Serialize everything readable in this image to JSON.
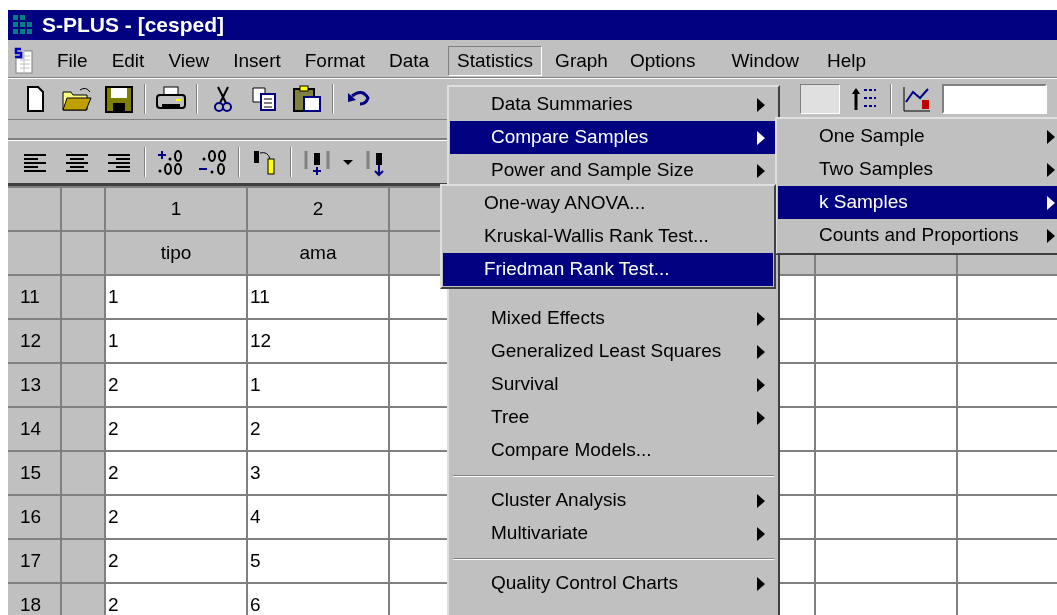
{
  "window": {
    "title": "S-PLUS - [cesped]"
  },
  "menubar": [
    {
      "label": "File",
      "selected": false
    },
    {
      "label": "Edit",
      "selected": false
    },
    {
      "label": "View",
      "selected": false
    },
    {
      "label": "Insert",
      "selected": false
    },
    {
      "label": "Format",
      "selected": false
    },
    {
      "label": "Data",
      "selected": false
    },
    {
      "label": "Statistics",
      "selected": true
    },
    {
      "label": "Graph",
      "selected": false
    },
    {
      "label": "Options",
      "selected": false
    },
    {
      "label": "Window",
      "selected": false
    },
    {
      "label": "Help",
      "selected": false
    }
  ],
  "grid": {
    "column_numbers": [
      "1",
      "2"
    ],
    "column_names": [
      "tipo",
      "ama"
    ],
    "rows": [
      {
        "row": "11",
        "cells": [
          "1",
          "11"
        ]
      },
      {
        "row": "12",
        "cells": [
          "1",
          "12"
        ]
      },
      {
        "row": "13",
        "cells": [
          "2",
          "1"
        ]
      },
      {
        "row": "14",
        "cells": [
          "2",
          "2"
        ]
      },
      {
        "row": "15",
        "cells": [
          "2",
          "3"
        ]
      },
      {
        "row": "16",
        "cells": [
          "2",
          "4"
        ]
      },
      {
        "row": "17",
        "cells": [
          "2",
          "5"
        ]
      },
      {
        "row": "18",
        "cells": [
          "2",
          "6"
        ]
      }
    ]
  },
  "statistics_menu": {
    "items_above": [
      {
        "kind": "item",
        "label": "Data Summaries",
        "submenu": true,
        "selected": false
      },
      {
        "kind": "item",
        "label": "Compare Samples",
        "submenu": true,
        "selected": true
      },
      {
        "kind": "item",
        "label": "Power and Sample Size",
        "submenu": true,
        "selected": false
      }
    ],
    "items_below": [
      {
        "kind": "item",
        "label": "Mixed Effects",
        "submenu": true,
        "selected": false
      },
      {
        "kind": "item",
        "label": "Generalized Least Squares",
        "submenu": true,
        "selected": false
      },
      {
        "kind": "item",
        "label": "Survival",
        "submenu": true,
        "selected": false
      },
      {
        "kind": "item",
        "label": "Tree",
        "submenu": true,
        "selected": false
      },
      {
        "kind": "item",
        "label": "Compare Models...",
        "submenu": false,
        "selected": false
      },
      {
        "kind": "separator"
      },
      {
        "kind": "item",
        "label": "Cluster Analysis",
        "submenu": true,
        "selected": false
      },
      {
        "kind": "item",
        "label": "Multivariate",
        "submenu": true,
        "selected": false
      },
      {
        "kind": "separator"
      },
      {
        "kind": "item",
        "label": "Quality Control Charts",
        "submenu": true,
        "selected": false
      }
    ]
  },
  "compare_samples_menu": {
    "items": [
      {
        "kind": "item",
        "label": "One Sample",
        "submenu": true,
        "selected": false
      },
      {
        "kind": "item",
        "label": "Two Samples",
        "submenu": true,
        "selected": false
      },
      {
        "kind": "item",
        "label": "k Samples",
        "submenu": true,
        "selected": true
      },
      {
        "kind": "item",
        "label": "Counts and Proportions",
        "submenu": true,
        "selected": false
      }
    ]
  },
  "k_samples_menu": {
    "items": [
      {
        "kind": "item",
        "label": "One-way ANOVA...",
        "submenu": false,
        "selected": false
      },
      {
        "kind": "item",
        "label": "Kruskal-Wallis Rank Test...",
        "submenu": false,
        "selected": false
      },
      {
        "kind": "item",
        "label": "Friedman Rank Test...",
        "submenu": false,
        "selected": true
      }
    ]
  }
}
